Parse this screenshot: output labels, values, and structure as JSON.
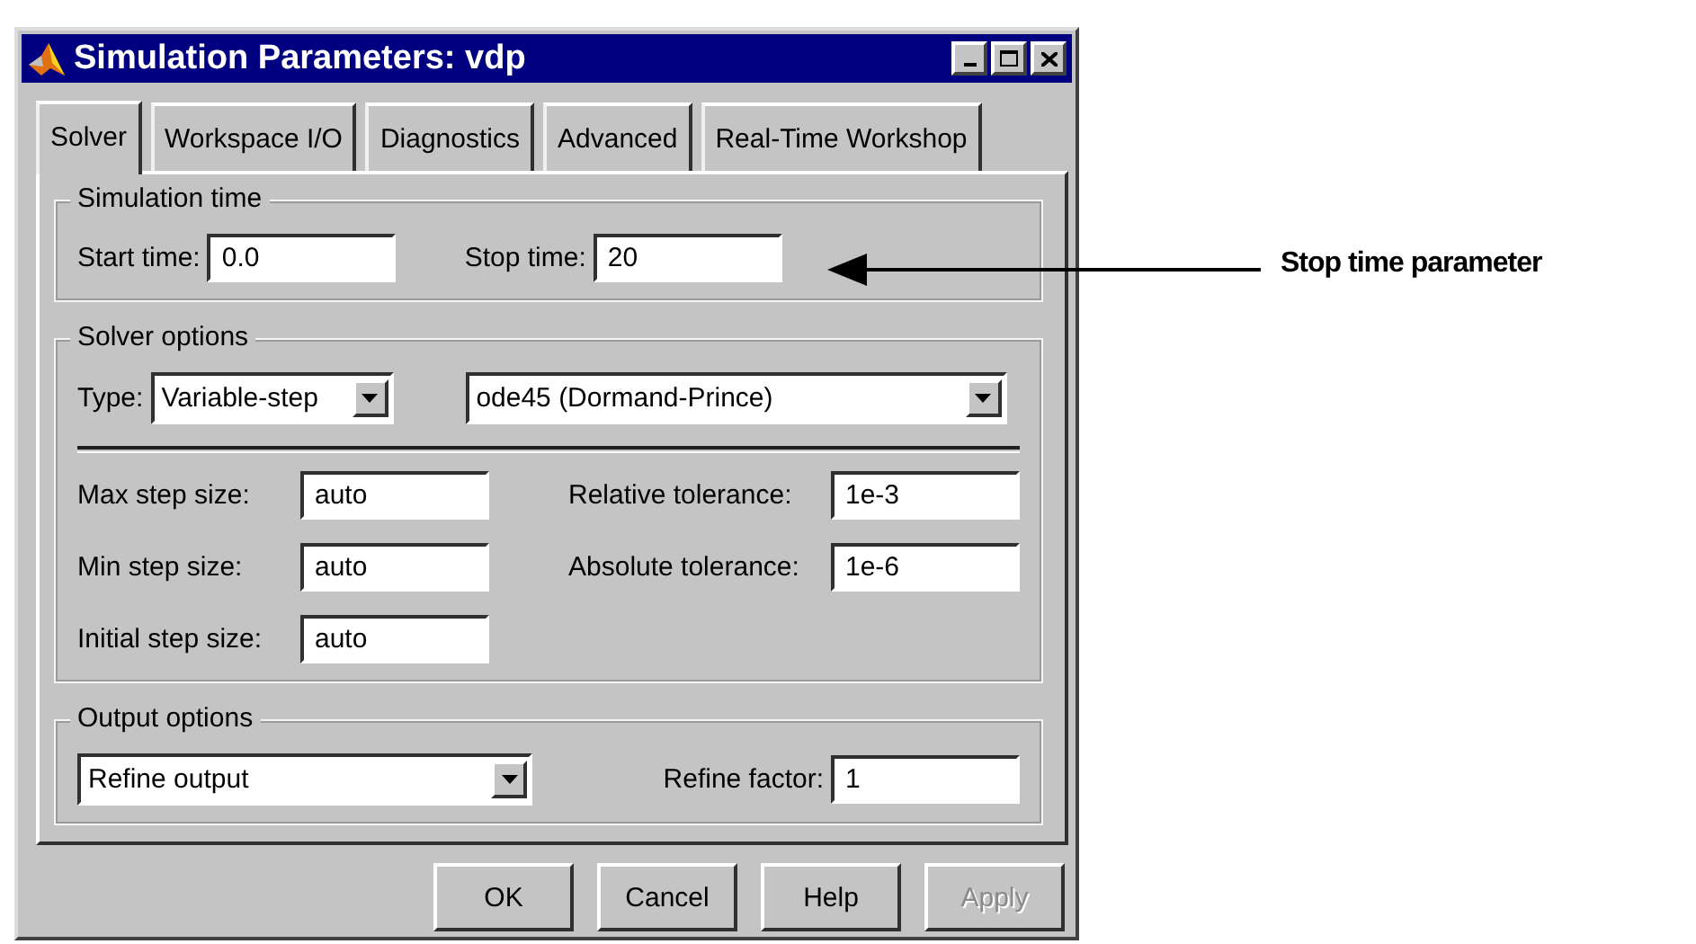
{
  "window": {
    "title": "Simulation Parameters: vdp"
  },
  "tabs": [
    {
      "label": "Solver",
      "selected": true
    },
    {
      "label": "Workspace I/O",
      "selected": false
    },
    {
      "label": "Diagnostics",
      "selected": false
    },
    {
      "label": "Advanced",
      "selected": false
    },
    {
      "label": "Real-Time Workshop",
      "selected": false
    }
  ],
  "simulation_time": {
    "legend": "Simulation time",
    "fields": [
      {
        "label": "Start time:",
        "value": "0.0"
      },
      {
        "label": "Stop time:",
        "value": "20"
      }
    ]
  },
  "solver_options": {
    "legend": "Solver options",
    "type_label": "Type:",
    "type_value": "Variable-step",
    "solver_value": "ode45 (Dormand-Prince)",
    "left_fields": [
      {
        "label": "Max step size:",
        "value": "auto"
      },
      {
        "label": "Min step size:",
        "value": "auto"
      },
      {
        "label": "Initial step size:",
        "value": "auto"
      }
    ],
    "right_fields": [
      {
        "label": "Relative tolerance:",
        "value": "1e-3"
      },
      {
        "label": "Absolute tolerance:",
        "value": "1e-6"
      }
    ]
  },
  "output_options": {
    "legend": "Output options",
    "mode_value": "Refine output",
    "factor_label": "Refine factor:",
    "factor_value": "1"
  },
  "buttons": [
    {
      "label": "OK",
      "disabled": false
    },
    {
      "label": "Cancel",
      "disabled": false
    },
    {
      "label": "Help",
      "disabled": false
    },
    {
      "label": "Apply",
      "disabled": true
    }
  ],
  "annotation": {
    "text": "Stop time parameter"
  }
}
